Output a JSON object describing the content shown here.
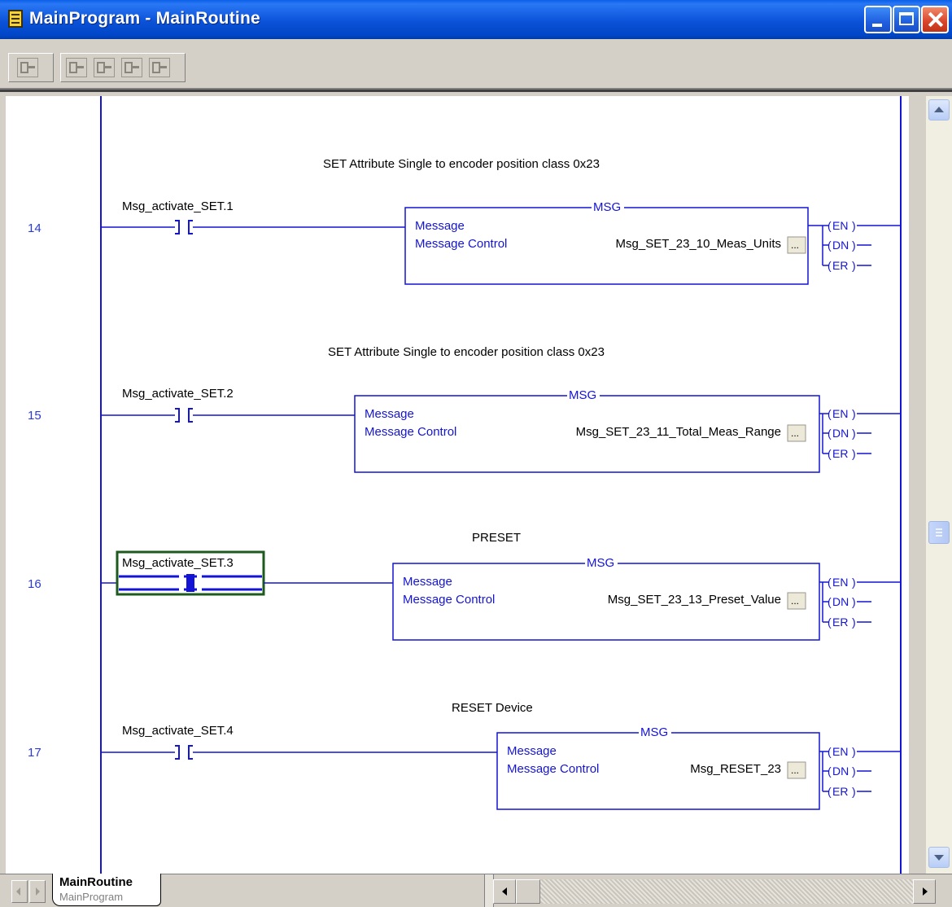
{
  "window": {
    "title": "MainProgram - MainRoutine"
  },
  "colors": {
    "rail": "#1414d4",
    "rung_number": "#2a3ad8",
    "selection": "#1e5a1e"
  },
  "rungs": [
    {
      "number": "14",
      "comment": "SET Attribute Single to encoder position class 0x23",
      "contact_tag": "Msg_activate_SET.1",
      "instruction": "MSG",
      "field1": "Message",
      "field2": "Message Control",
      "control_tag": "Msg_SET_23_10_Meas_Units",
      "browse": "...",
      "coils": [
        "EN",
        "DN",
        "ER"
      ]
    },
    {
      "number": "15",
      "comment": "SET Attribute Single to encoder position class 0x23",
      "contact_tag": "Msg_activate_SET.2",
      "instruction": "MSG",
      "field1": "Message",
      "field2": "Message Control",
      "control_tag": "Msg_SET_23_11_Total_Meas_Range",
      "browse": "...",
      "coils": [
        "EN",
        "DN",
        "ER"
      ]
    },
    {
      "number": "16",
      "comment": "PRESET",
      "contact_tag": "Msg_activate_SET.3",
      "instruction": "MSG",
      "field1": "Message",
      "field2": "Message Control",
      "control_tag": "Msg_SET_23_13_Preset_Value",
      "browse": "...",
      "coils": [
        "EN",
        "DN",
        "ER"
      ]
    },
    {
      "number": "17",
      "comment": "RESET Device",
      "contact_tag": "Msg_activate_SET.4",
      "instruction": "MSG",
      "field1": "Message",
      "field2": "Message Control",
      "control_tag": "Msg_RESET_23",
      "browse": "...",
      "coils": [
        "EN",
        "DN",
        "ER"
      ]
    }
  ],
  "bottom_tab": {
    "routine": "MainRoutine",
    "program": "MainProgram"
  }
}
